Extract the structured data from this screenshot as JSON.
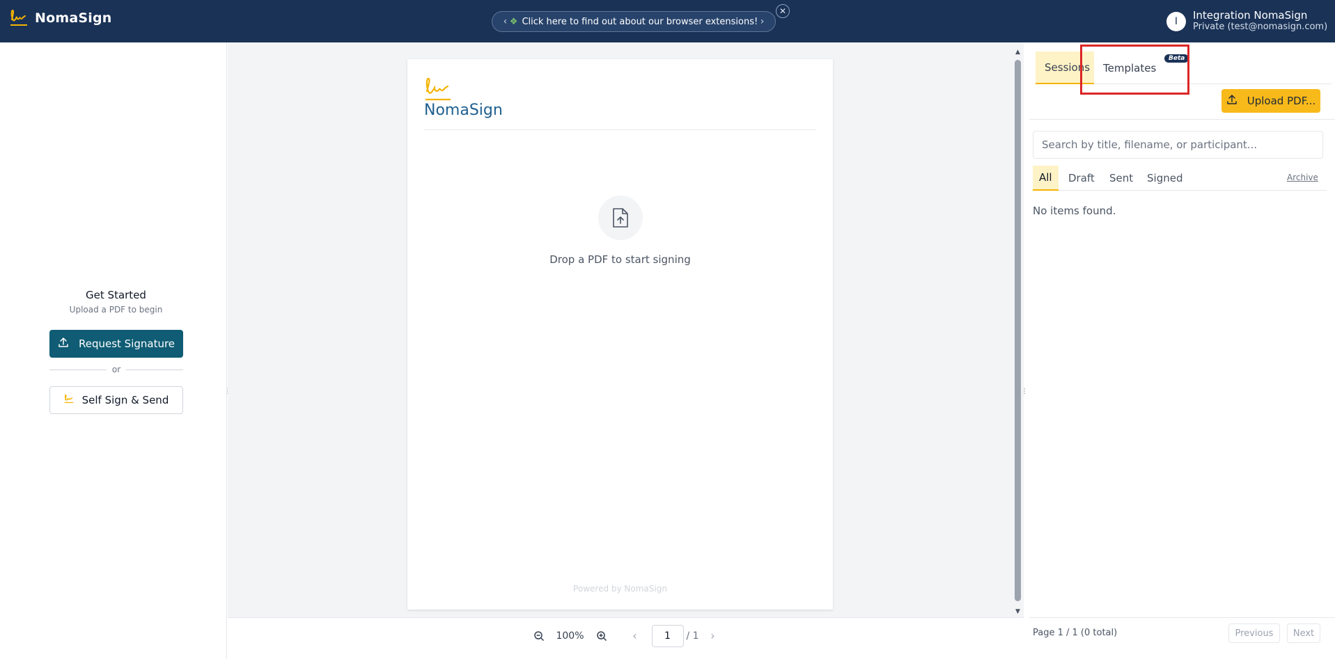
{
  "header": {
    "brand_name": "NomaSign",
    "promo_text": "Click here to find out about our browser extensions!",
    "user_initial": "I",
    "user_name": "Integration NomaSign",
    "user_account": "Private (test@nomasign.com)"
  },
  "left_panel": {
    "title": "Get Started",
    "subtitle": "Upload a PDF to begin",
    "request_button": "Request Signature",
    "or_label": "or",
    "self_sign_button": "Self Sign & Send"
  },
  "document": {
    "brand": "NomaSign",
    "drop_text": "Drop a PDF to start signing",
    "powered_by": "Powered by NomaSign"
  },
  "toolbar": {
    "zoom": "100%",
    "page_value": "1",
    "page_total": "/ 1"
  },
  "right_panel": {
    "tabs": [
      {
        "label": "Sessions",
        "active": true
      },
      {
        "label": "Templates",
        "badge": "Beta"
      }
    ],
    "upload_button": "Upload PDF...",
    "search_placeholder": "Search by title, filename, or participant...",
    "filters": [
      {
        "label": "All",
        "active": true
      },
      {
        "label": "Draft"
      },
      {
        "label": "Sent"
      },
      {
        "label": "Signed"
      }
    ],
    "archive_link": "Archive",
    "empty_message": "No items found.",
    "pager_text": "Page 1 / 1 (0 total)",
    "previous": "Previous",
    "next": "Next"
  },
  "colors": {
    "header_bg": "#1a3256",
    "primary_teal": "#0f5c74",
    "accent_yellow": "#f8b91a",
    "highlight_red": "#dc2626"
  },
  "icons": [
    "signature-logo-icon",
    "chevron-left-icon",
    "puzzle-icon",
    "chevron-right-icon",
    "close-icon",
    "upload-icon",
    "signature-icon",
    "file-upload-icon",
    "zoom-out-icon",
    "zoom-in-icon",
    "grip-icon"
  ]
}
